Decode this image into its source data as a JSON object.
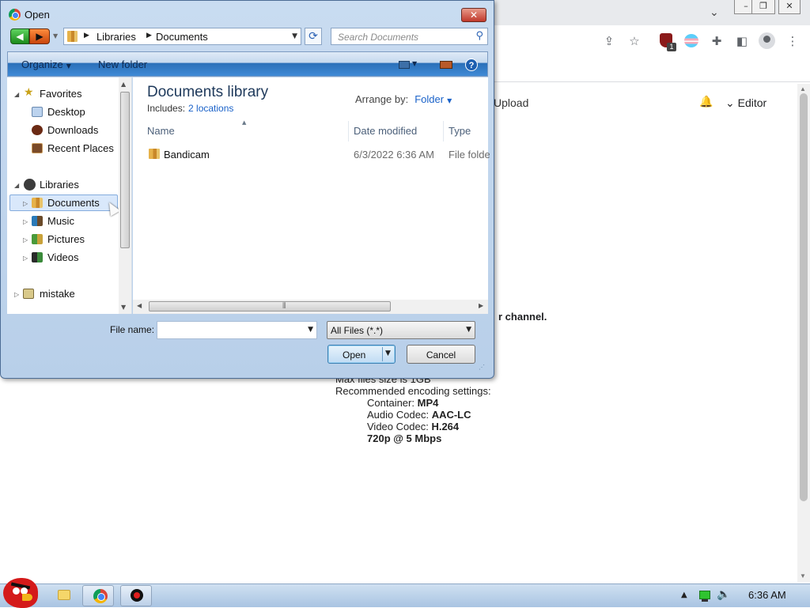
{
  "browser": {
    "tabstrip_dropdown_icon": "chevron-down-icon",
    "window_controls": [
      "minimize-icon",
      "restore-icon",
      "close-icon"
    ],
    "toolbar_icons": [
      "share-icon",
      "star-icon",
      "extension-shield-icon",
      "transgender-flag-extension-icon",
      "puzzle-icon",
      "side-panel-icon",
      "profile-avatar-icon",
      "more-vert-icon"
    ],
    "extension_badge": "1"
  },
  "page": {
    "upload_label": "Upload",
    "editor_label": "Editor",
    "channel_text": "r channel.",
    "info": {
      "line1": "Max files size is 1GB",
      "line2": "Recommended encoding settings:",
      "container_label": "Container:",
      "container_value": "MP4",
      "audio_label": "Audio Codec:",
      "audio_value": "AAC-LC",
      "video_label": "Video Codec:",
      "video_value": "H.264",
      "quality": "720p @ 5 Mbps"
    }
  },
  "dialog": {
    "title": "Open",
    "close_glyph": "✕",
    "address": {
      "crumbs": [
        "Libraries",
        "Documents"
      ]
    },
    "search_placeholder": "Search Documents",
    "commands": {
      "organize": "Organize",
      "new_folder": "New folder",
      "help": "?"
    },
    "nav": {
      "favorites_header": "Favorites",
      "favorites": [
        "Desktop",
        "Downloads",
        "Recent Places"
      ],
      "libraries_header": "Libraries",
      "libraries": [
        "Documents",
        "Music",
        "Pictures",
        "Videos"
      ],
      "selected": "Documents",
      "other": "mistake"
    },
    "library": {
      "title": "Documents library",
      "includes_label": "Includes:",
      "includes_link": "2 locations",
      "arrange_label": "Arrange by:",
      "arrange_value": "Folder"
    },
    "columns": [
      "Name",
      "Date modified",
      "Type"
    ],
    "files": [
      {
        "name": "Bandicam",
        "date": "6/3/2022 6:36 AM",
        "type": "File folder"
      }
    ],
    "filename_label": "File name:",
    "filename_value": "",
    "filetype_value": "All Files (*.*)",
    "open_label": "Open",
    "cancel_label": "Cancel"
  },
  "taskbar": {
    "clock": "6:36 AM"
  }
}
